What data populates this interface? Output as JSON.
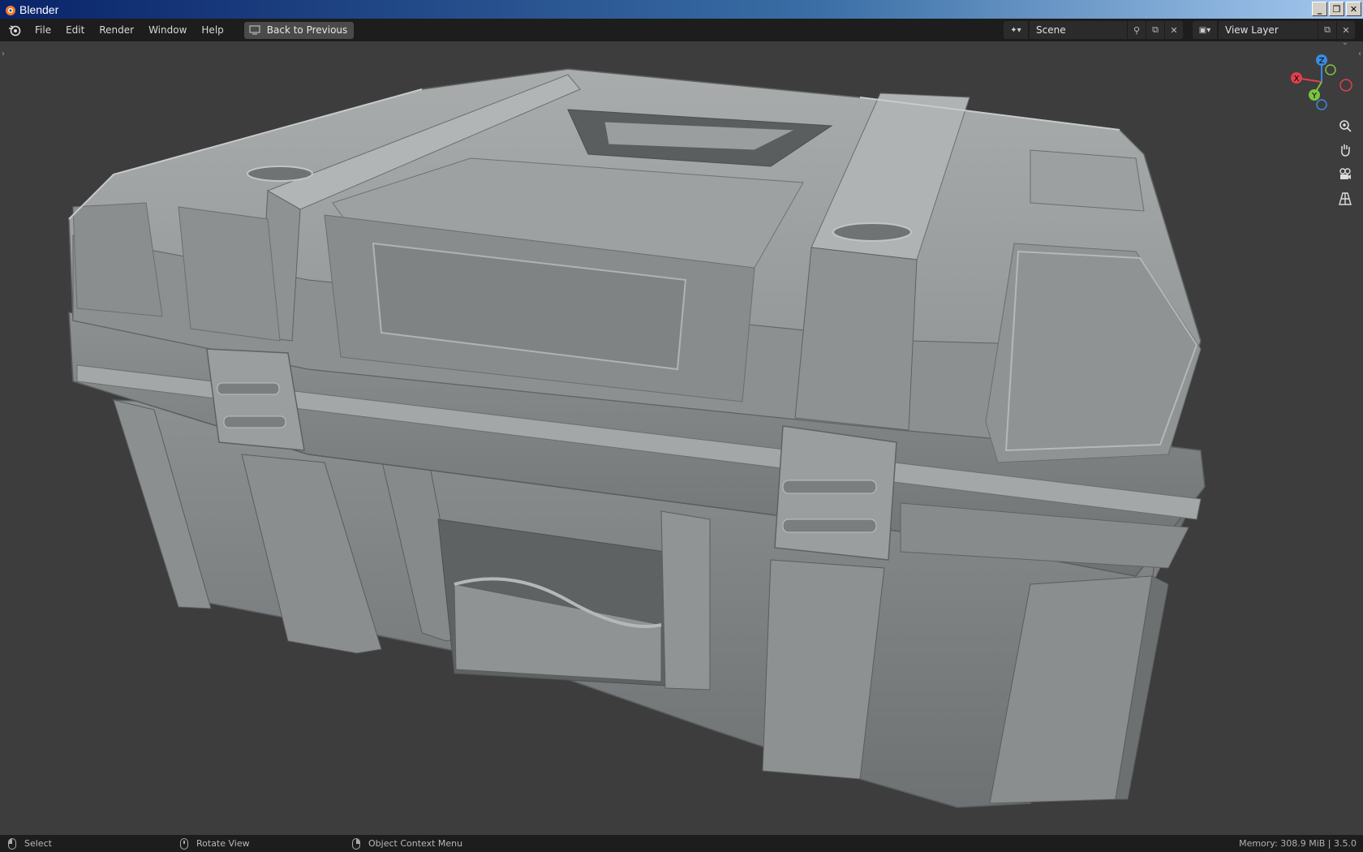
{
  "window": {
    "title": "Blender",
    "buttons": [
      "minimize",
      "restore",
      "close"
    ]
  },
  "menubar": {
    "items": [
      {
        "label": "File"
      },
      {
        "label": "Edit"
      },
      {
        "label": "Render"
      },
      {
        "label": "Window"
      },
      {
        "label": "Help"
      }
    ],
    "back_button": "Back to Previous",
    "scene": {
      "value": "Scene"
    },
    "view_layer": {
      "value": "View Layer"
    }
  },
  "viewport": {
    "object": "hard-surface crate model",
    "gizmo": {
      "axes": [
        "Z",
        "X",
        "Y"
      ]
    },
    "nav_buttons": [
      "zoom-icon",
      "pan-hand-icon",
      "camera-icon",
      "grid-perspective-icon"
    ]
  },
  "statusbar": {
    "select": "Select",
    "rotate": "Rotate View",
    "context": "Object Context Menu",
    "memory": "Memory: 308.9 MiB | 3.5.0"
  },
  "colors": {
    "background": "#3d3d3d",
    "header": "#1d1d1d",
    "axis_x": "#e0404e",
    "axis_y": "#7ac442",
    "axis_z": "#3b8bdf"
  }
}
